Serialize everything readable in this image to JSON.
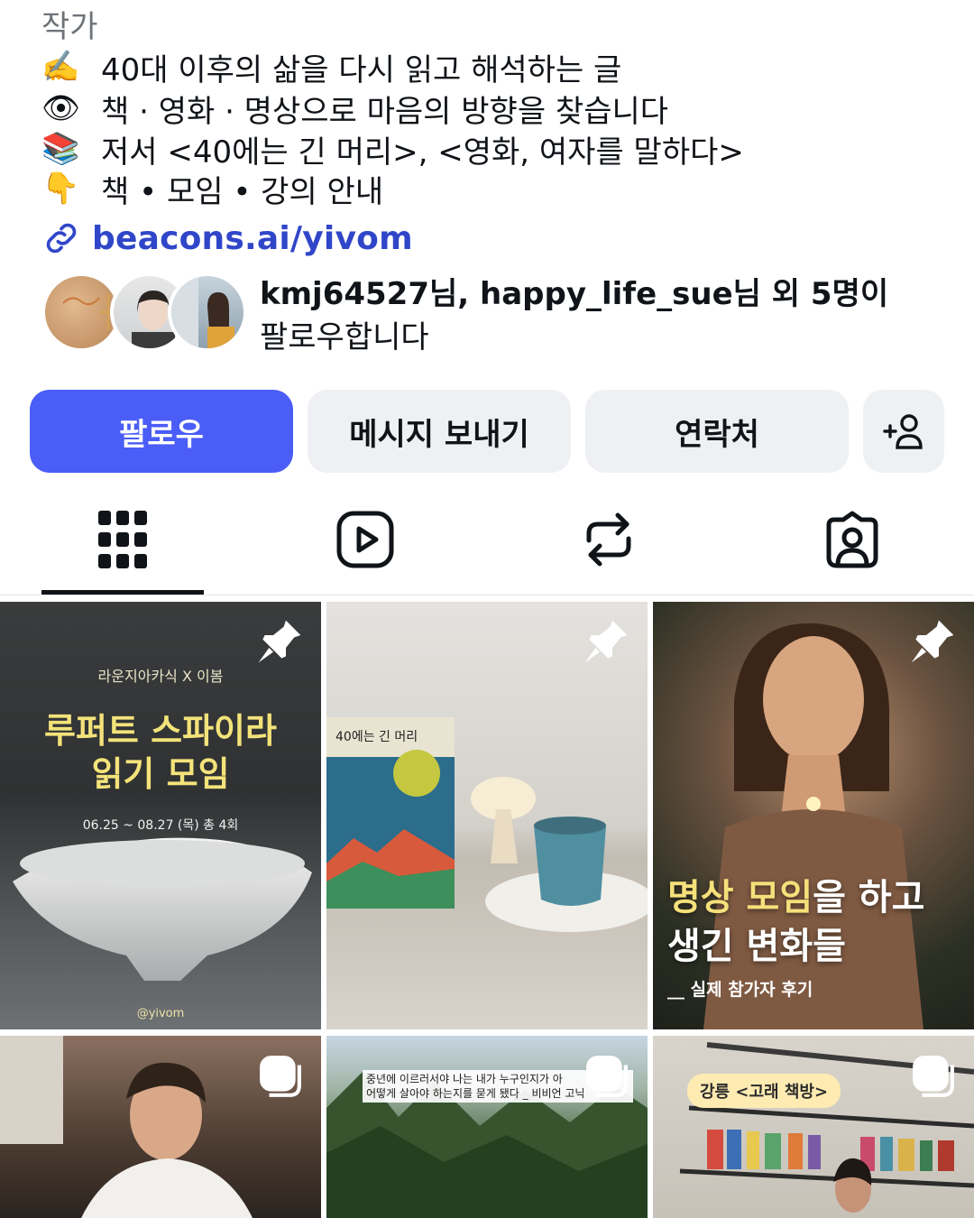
{
  "profile": {
    "category": "작가",
    "bio": [
      {
        "icon": "writing-hand-icon",
        "emoji": "✍️",
        "text": "40대 이후의 삶을 다시 읽고 해석하는 글"
      },
      {
        "icon": "eye-icon",
        "emoji": "👁",
        "text": "책 · 영화 · 명상으로 마음의 방향을 찾습니다"
      },
      {
        "icon": "books-icon",
        "emoji": "📚",
        "text": "저서 <40에는 긴 머리>, <영화, 여자를 말하다>"
      },
      {
        "icon": "pointing-down-icon",
        "emoji": "👇",
        "text": "책 • 모임 • 강의 안내"
      }
    ],
    "link": "beacons.ai/yivom",
    "followed_by": {
      "names": "kmj64527님, happy_life_sue님 외 5명이",
      "suffix": "팔로우합니다"
    }
  },
  "actions": {
    "follow": "팔로우",
    "message": "메시지 보내기",
    "contact": "연락처",
    "add_person": "+"
  },
  "tabs": [
    {
      "name": "grid",
      "active": true
    },
    {
      "name": "reels",
      "active": false
    },
    {
      "name": "reposts",
      "active": false
    },
    {
      "name": "tagged",
      "active": false
    }
  ],
  "posts": {
    "p1": {
      "brand": "라운지아카식 X 이봄",
      "title_line1": "루퍼트 스파이라",
      "title_line2": "읽기 모임",
      "date": "06.25 ~ 08.27 (목) 총 4회",
      "handle": "@yivom",
      "pinned": true
    },
    "p2": {
      "book_title": "40에는 긴 머리",
      "pinned": true
    },
    "p3": {
      "caption_accent1": "명상",
      "caption_accent2": "모임",
      "caption_rest1": "을 하고",
      "caption_line2": "생긴 변화들",
      "sub": "__ 실제 참가자 후기",
      "pinned": true
    },
    "p4": {
      "type": "reel"
    },
    "p5": {
      "caption_line1": "중년에 이르러서야 나는 내가 누구인지가 아",
      "caption_line2": "어떻게 살아야 하는지를 묻게 됐다 _ 비비언 고닉",
      "type": "reel"
    },
    "p6": {
      "label": "강릉 <고래 책방>",
      "type": "reel"
    }
  },
  "colors": {
    "primary": "#4a5df6",
    "link": "#3046c9",
    "button_bg": "#eff0f3",
    "accent_yellow": "#f3e37a"
  }
}
